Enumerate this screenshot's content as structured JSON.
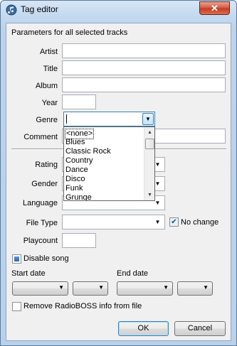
{
  "window": {
    "title": "Tag editor",
    "close_glyph": "✕",
    "icon": "music-note-icon"
  },
  "section_title": "Parameters for all selected tracks",
  "fields": {
    "artist_label": "Artist",
    "title_label": "Title",
    "album_label": "Album",
    "year_label": "Year",
    "genre_label": "Genre",
    "comment_label": "Comment",
    "rating_label": "Rating",
    "gender_label": "Gender",
    "language_label": "Language",
    "file_type_label": "File Type",
    "playcount_label": "Playcount",
    "artist_value": "",
    "title_value": "",
    "album_value": "",
    "year_value": "",
    "genre_value": "",
    "comment_value": "",
    "file_type_value": "",
    "playcount_value": ""
  },
  "genre_list": {
    "items": [
      "<none>",
      "Blues",
      "Classic Rock",
      "Country",
      "Dance",
      "Disco",
      "Funk",
      "Grunge"
    ],
    "selected_index": 0
  },
  "checkboxes": {
    "no_change_label": "No change",
    "no_change_checked": true,
    "disable_song_label": "Disable song",
    "disable_song_state": "indeterminate",
    "remove_info_label": "Remove RadioBOSS info from file",
    "remove_info_checked": false
  },
  "dates": {
    "start_label": "Start date",
    "end_label": "End date"
  },
  "buttons": {
    "ok_label": "OK",
    "cancel_label": "Cancel"
  },
  "glyphs": {
    "dropdown_arrow": "▼",
    "scroll_up": "▲",
    "scroll_down": "▼",
    "check": "✔"
  },
  "colors": {
    "title_bar": "#c3d9ef",
    "close_button": "#c7381e",
    "dialog_bg": "#f0f0f0",
    "focus_border": "#569de5"
  }
}
